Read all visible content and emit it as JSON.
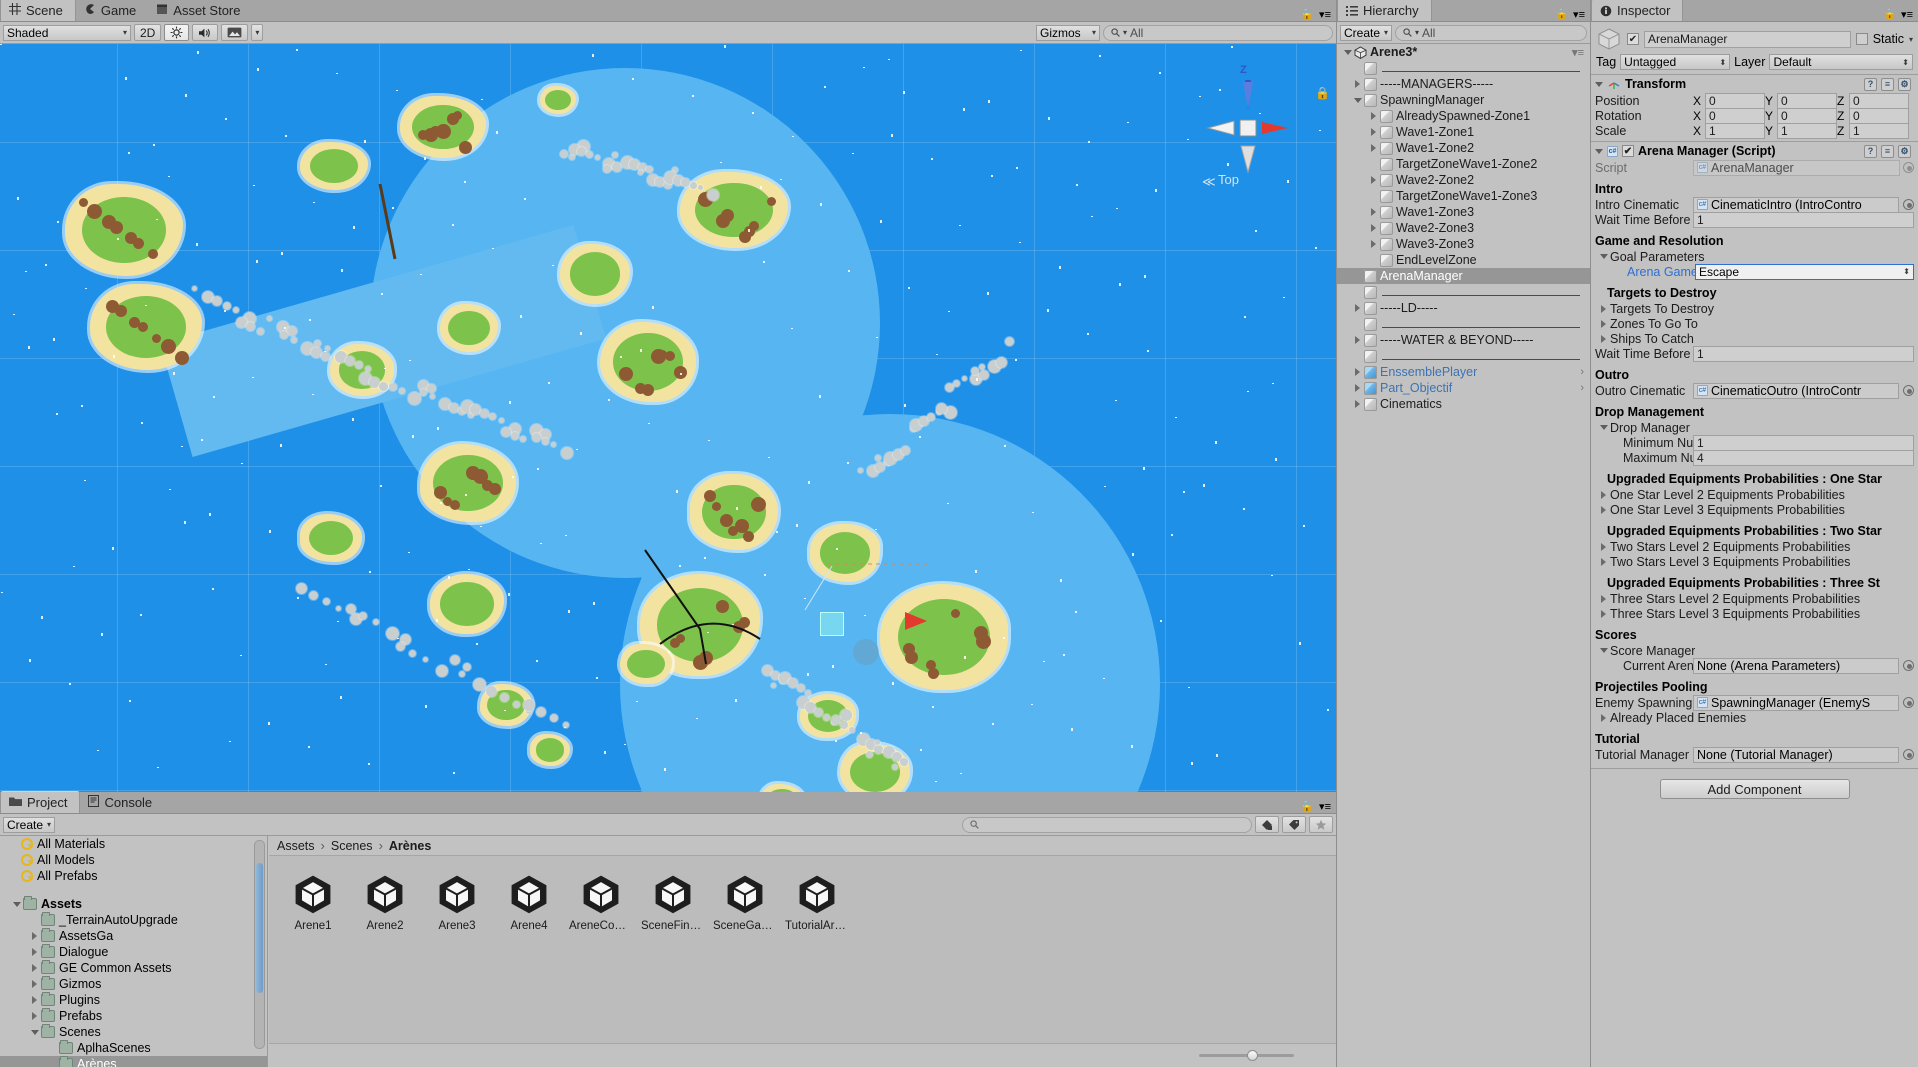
{
  "scene": {
    "tabs": [
      {
        "label": "Scene",
        "icon": "grid-icon",
        "active": true
      },
      {
        "label": "Game",
        "icon": "gamepad-icon",
        "active": false
      },
      {
        "label": "Asset Store",
        "icon": "store-icon",
        "active": false
      }
    ],
    "toolbar": {
      "shading": "Shaded",
      "mode_2d": "2D",
      "light_icon": "sun-icon",
      "audio_icon": "speaker-icon",
      "fx_icon": "image-icon",
      "gizmos": "Gizmos",
      "search_placeholder": "All"
    },
    "gizmo": {
      "axis_z": "Z",
      "view_label": "Top"
    },
    "colors": {
      "water": "#1e90e8",
      "zone": "#57b6f2",
      "sand": "#f3e3a0",
      "grass": "#7cc24b"
    }
  },
  "hierarchy": {
    "tab": "Hierarchy",
    "create": "Create",
    "search_placeholder": "All",
    "scene_name": "Arene3*",
    "items": [
      {
        "label": "",
        "depth": 1,
        "fold": "none",
        "separator": true
      },
      {
        "label": "-----MANAGERS-----",
        "depth": 1,
        "fold": "collapsed"
      },
      {
        "label": "SpawningManager",
        "depth": 1,
        "fold": "expanded"
      },
      {
        "label": "AlreadySpawned-Zone1",
        "depth": 2,
        "fold": "collapsed"
      },
      {
        "label": "Wave1-Zone1",
        "depth": 2,
        "fold": "collapsed"
      },
      {
        "label": "Wave1-Zone2",
        "depth": 2,
        "fold": "collapsed"
      },
      {
        "label": "TargetZoneWave1-Zone2",
        "depth": 2,
        "fold": "none"
      },
      {
        "label": "Wave2-Zone2",
        "depth": 2,
        "fold": "collapsed"
      },
      {
        "label": "TargetZoneWave1-Zone3",
        "depth": 2,
        "fold": "none"
      },
      {
        "label": "Wave1-Zone3",
        "depth": 2,
        "fold": "collapsed"
      },
      {
        "label": "Wave2-Zone3",
        "depth": 2,
        "fold": "collapsed"
      },
      {
        "label": "Wave3-Zone3",
        "depth": 2,
        "fold": "collapsed"
      },
      {
        "label": "EndLevelZone",
        "depth": 2,
        "fold": "none"
      },
      {
        "label": "ArenaManager",
        "depth": 1,
        "fold": "none",
        "selected": true
      },
      {
        "label": "",
        "depth": 1,
        "fold": "none",
        "separator": true
      },
      {
        "label": "-----LD-----",
        "depth": 1,
        "fold": "collapsed"
      },
      {
        "label": "",
        "depth": 1,
        "fold": "none",
        "separator": true
      },
      {
        "label": "-----WATER & BEYOND-----",
        "depth": 1,
        "fold": "collapsed"
      },
      {
        "label": "",
        "depth": 1,
        "fold": "none",
        "separator": true
      },
      {
        "label": "EnssemblePlayer",
        "depth": 1,
        "fold": "collapsed",
        "prefab": true,
        "chevron": true
      },
      {
        "label": "Part_Objectif",
        "depth": 1,
        "fold": "collapsed",
        "prefab": true,
        "chevron": true
      },
      {
        "label": "Cinematics",
        "depth": 1,
        "fold": "collapsed"
      }
    ]
  },
  "inspector": {
    "tab": "Inspector",
    "object_name": "ArenaManager",
    "enabled": true,
    "static_label": "Static",
    "tag_label": "Tag",
    "tag_value": "Untagged",
    "layer_label": "Layer",
    "layer_value": "Default",
    "transform": {
      "title": "Transform",
      "rows": [
        {
          "label": "Position",
          "x": "0",
          "y": "0",
          "z": "0"
        },
        {
          "label": "Rotation",
          "x": "0",
          "y": "0",
          "z": "0"
        },
        {
          "label": "Scale",
          "x": "1",
          "y": "1",
          "z": "1"
        }
      ]
    },
    "script_component": {
      "title": "Arena Manager (Script)",
      "enabled": true,
      "script_label": "Script",
      "script_value": "ArenaManager",
      "groups": [
        {
          "header": "Intro",
          "rows": [
            {
              "type": "object",
              "label": "Intro Cinematic",
              "value": "CinematicIntro (IntroContro"
            },
            {
              "type": "text",
              "label": "Wait Time Before Int",
              "value": "1"
            }
          ]
        },
        {
          "header": "Game and Resolution",
          "rows": [
            {
              "type": "foldout",
              "label": "Goal Parameters",
              "state": "expanded"
            },
            {
              "type": "popup",
              "label": "Arena Game Mode",
              "value": "Escape",
              "indent": 2,
              "highlight": true
            }
          ]
        },
        {
          "header": "Targets to Destroy",
          "indent": true,
          "rows": [
            {
              "type": "foldout",
              "label": "Targets To Destroy",
              "state": "collapsed"
            },
            {
              "type": "foldout",
              "label": "Zones To Go To",
              "state": "collapsed"
            },
            {
              "type": "foldout",
              "label": "Ships To Catch",
              "state": "collapsed"
            },
            {
              "type": "text",
              "label": "Wait Time Before Ou",
              "value": "1"
            }
          ]
        },
        {
          "header": "Outro",
          "rows": [
            {
              "type": "object",
              "label": "Outro Cinematic",
              "value": "CinematicOutro (IntroContr"
            }
          ]
        },
        {
          "header": "Drop Management",
          "rows": [
            {
              "type": "foldout",
              "label": "Drop Manager",
              "state": "expanded"
            },
            {
              "type": "text",
              "label": "Minimum Number",
              "value": "1",
              "indent": 2
            },
            {
              "type": "text",
              "label": "Maximum Number",
              "value": "4",
              "indent": 2
            }
          ]
        },
        {
          "header": "Upgraded Equipments Probabilities : One Star",
          "indent": true,
          "rows": [
            {
              "type": "foldout",
              "label": "One Star Level 2 Equipments Probabilities",
              "state": "collapsed"
            },
            {
              "type": "foldout",
              "label": "One Star Level 3 Equipments Probabilities",
              "state": "collapsed"
            }
          ]
        },
        {
          "header": "Upgraded Equipments Probabilities : Two Star",
          "indent": true,
          "rows": [
            {
              "type": "foldout",
              "label": "Two Stars Level 2 Equipments Probabilities",
              "state": "collapsed"
            },
            {
              "type": "foldout",
              "label": "Two Stars Level 3 Equipments Probabilities",
              "state": "collapsed"
            }
          ]
        },
        {
          "header": "Upgraded Equipments Probabilities : Three St",
          "indent": true,
          "rows": [
            {
              "type": "foldout",
              "label": "Three Stars Level 2 Equipments Probabilities",
              "state": "collapsed"
            },
            {
              "type": "foldout",
              "label": "Three Stars Level 3 Equipments Probabilities",
              "state": "collapsed"
            }
          ]
        },
        {
          "header": "Scores",
          "rows": [
            {
              "type": "foldout",
              "label": "Score Manager",
              "state": "expanded"
            },
            {
              "type": "object",
              "label": "Current Arena Par",
              "value": "None (Arena Parameters)",
              "indent": 2,
              "none": true
            }
          ]
        },
        {
          "header": "Projectiles Pooling",
          "rows": [
            {
              "type": "object",
              "label": "Enemy Spawning Ma",
              "value": "SpawningManager (EnemyS"
            },
            {
              "type": "foldout",
              "label": "Already Placed Enemies",
              "state": "collapsed"
            }
          ]
        },
        {
          "header": "Tutorial",
          "rows": [
            {
              "type": "object",
              "label": "Tutorial Manager",
              "value": "None (Tutorial Manager)",
              "none": true
            }
          ]
        }
      ]
    },
    "add_component": "Add Component"
  },
  "project": {
    "tabs": [
      {
        "label": "Project",
        "icon": "folder-icon",
        "active": true
      },
      {
        "label": "Console",
        "icon": "console-icon",
        "active": false
      }
    ],
    "create": "Create",
    "search_placeholder": "",
    "filter_icons": [
      "type-filter-icon",
      "label-filter-icon",
      "favorite-icon"
    ],
    "tree": [
      {
        "label": "All Materials",
        "kind": "search"
      },
      {
        "label": "All Models",
        "kind": "search"
      },
      {
        "label": "All Prefabs",
        "kind": "search"
      },
      {
        "label": "",
        "kind": "spacer"
      },
      {
        "label": "Assets",
        "kind": "folder",
        "depth": 0,
        "fold": "expanded",
        "bold": true
      },
      {
        "label": "_TerrainAutoUpgrade",
        "kind": "folder",
        "depth": 1,
        "fold": "none"
      },
      {
        "label": "AssetsGa",
        "kind": "folder",
        "depth": 1,
        "fold": "collapsed"
      },
      {
        "label": "Dialogue",
        "kind": "folder",
        "depth": 1,
        "fold": "collapsed"
      },
      {
        "label": "GE Common Assets",
        "kind": "folder",
        "depth": 1,
        "fold": "collapsed"
      },
      {
        "label": "Gizmos",
        "kind": "folder",
        "depth": 1,
        "fold": "collapsed"
      },
      {
        "label": "Plugins",
        "kind": "folder",
        "depth": 1,
        "fold": "collapsed"
      },
      {
        "label": "Prefabs",
        "kind": "folder",
        "depth": 1,
        "fold": "collapsed"
      },
      {
        "label": "Scenes",
        "kind": "folder",
        "depth": 1,
        "fold": "expanded"
      },
      {
        "label": "AplhaScenes",
        "kind": "folder",
        "depth": 2,
        "fold": "none"
      },
      {
        "label": "Arènes",
        "kind": "folder",
        "depth": 2,
        "fold": "none",
        "selected": true
      }
    ],
    "breadcrumb": [
      "Assets",
      "Scenes",
      "Arènes"
    ],
    "assets": [
      {
        "name": "Arene1",
        "icon": "unity-scene-icon"
      },
      {
        "name": "Arene2",
        "icon": "unity-scene-icon"
      },
      {
        "name": "Arene3",
        "icon": "unity-scene-icon"
      },
      {
        "name": "Arene4",
        "icon": "unity-scene-icon"
      },
      {
        "name": "AreneComp...",
        "icon": "unity-scene-icon"
      },
      {
        "name": "SceneFinal...",
        "icon": "unity-scene-icon"
      },
      {
        "name": "SceneGang...",
        "icon": "unity-scene-icon"
      },
      {
        "name": "TutorialAre...",
        "icon": "unity-scene-icon"
      }
    ],
    "zoom_slider": 50
  }
}
